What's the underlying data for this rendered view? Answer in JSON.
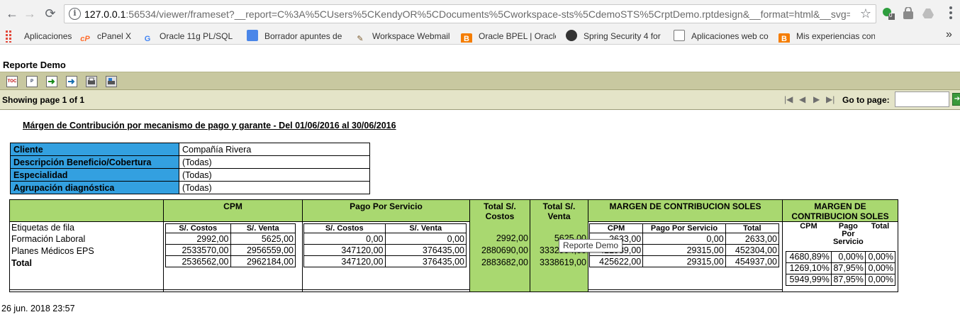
{
  "browser": {
    "url_host": "127.0.0.1",
    "url_rest": ":56534/viewer/frameset?__report=C%3A%5CUsers%5CKendyOR%5CDocuments%5Cworkspace-sts%5CdemoSTS%5CrptDemo.rptdesign&__format=html&__svg=true...",
    "info_glyph": "i",
    "ext_badge": "0",
    "bookmarks": [
      "Aplicaciones",
      "cPanel X",
      "Oracle 11g PL/SQL :",
      "Borrador apuntes de",
      "Workspace Webmail",
      "Oracle BPEL | Oracle",
      "Spring Security 4 for",
      "Aplicaciones web co",
      "Mis experiencias con"
    ],
    "bookmark_icon_glyphs": [
      "cP",
      "G",
      "",
      "",
      "B",
      "",
      "",
      "B"
    ]
  },
  "viewer": {
    "title": "Reporte Demo",
    "toolbar_icons": [
      "toc-icon",
      "parameters-icon",
      "export-data-icon",
      "export-report-icon",
      "print-icon",
      "print-server-icon"
    ],
    "toolbar_icon_glyphs": [
      "TOC",
      "P",
      "",
      "",
      "",
      ""
    ],
    "showing": "Showing page  1  of  1",
    "goto_label": "Go to page:",
    "goto_value": "",
    "goto_btn": "➔"
  },
  "report": {
    "title": "Márgen de Contribución por mecanismo de pago y garante - Del 01/06/2016 al 30/06/2016",
    "filters": [
      {
        "label": "Cliente",
        "value": "Compañía Rivera"
      },
      {
        "label": "Descripción Beneficio/Cobertura",
        "value": "(Todas)"
      },
      {
        "label": "Especialidad",
        "value": "(Todas)"
      },
      {
        "label": "Agrupación diagnóstica",
        "value": "(Todas)"
      }
    ],
    "pivot": {
      "headers": {
        "cpm": "CPM",
        "pps": "Pago Por Servicio",
        "total_costos": "Total S/. Costos",
        "total_venta": "Total S/. Venta",
        "margen_soles": "MARGEN DE CONTRIBUCION SOLES",
        "margen_pct": "MARGEN DE CONTRIBUCION SOLES"
      },
      "row_header": "Etiquetas de fila",
      "rows": [
        "Formación Laboral",
        "Planes Médicos EPS",
        "Total"
      ],
      "cpm": {
        "cols": [
          "S/. Costos",
          "S/. Venta"
        ],
        "values": [
          [
            "2992,00",
            "5625,00"
          ],
          [
            "2533570,00",
            "2956559,00"
          ],
          [
            "2536562,00",
            "2962184,00"
          ]
        ]
      },
      "pps": {
        "cols": [
          "S/. Costos",
          "S/. Venta"
        ],
        "values": [
          [
            "0,00",
            "0,00"
          ],
          [
            "347120,00",
            "376435,00"
          ],
          [
            "347120,00",
            "376435,00"
          ]
        ]
      },
      "total_costos": [
        "2992,00",
        "2880690,00",
        "2883682,00"
      ],
      "total_venta": [
        "5625,00",
        "3332994,00",
        "3338619,00"
      ],
      "margen_soles": {
        "cols": [
          "CPM",
          "Pago Por Servicio",
          "Total"
        ],
        "values": [
          [
            "2633,00",
            "0,00",
            "2633,00"
          ],
          [
            "422989,00",
            "29315,00",
            "452304,00"
          ],
          [
            "425622,00",
            "29315,00",
            "454937,00"
          ]
        ]
      },
      "margen_pct": {
        "cols": [
          "CPM",
          "Pago Por Servicio",
          "Total"
        ],
        "values": [
          [
            "4680,89%",
            "0,00%",
            "0,00%"
          ],
          [
            "1269,10%",
            "87,95%",
            "0,00%"
          ],
          [
            "5949,99%",
            "87,95%",
            "0,00%"
          ]
        ]
      }
    },
    "tooltip": "Reporte Demo",
    "footer_date": "26 jun. 2018 23:57"
  }
}
